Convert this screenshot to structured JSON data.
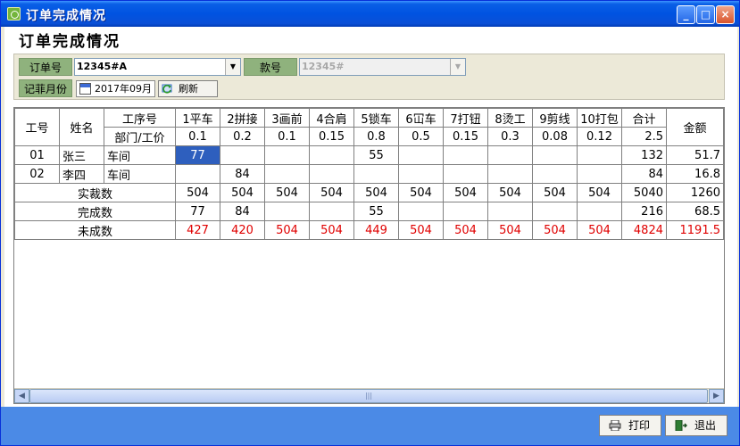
{
  "window": {
    "title": "订单完成情况",
    "min_glyph": "_",
    "max_glyph": "□",
    "close_glyph": "×"
  },
  "header": {
    "title": "订单完成情况"
  },
  "filter": {
    "order_label": "订单号",
    "order_value": "12345#A",
    "style_label": "款号",
    "style_value": "12345#",
    "month_label": "记菲月份",
    "month_value": "2017年09月",
    "refresh_label": "刷新"
  },
  "grid": {
    "h_id": "工号",
    "h_name": "姓名",
    "h_process": "工序号",
    "h_dept": "部门/工价",
    "h_total": "合计",
    "h_amount": "金额",
    "processes": [
      "1平车",
      "2拼接",
      "3画前",
      "4合肩",
      "5锁车",
      "6冚车",
      "7打钮",
      "8烫工",
      "9剪线",
      "10打包"
    ],
    "prices": [
      "0.1",
      "0.2",
      "0.1",
      "0.15",
      "0.8",
      "0.5",
      "0.15",
      "0.3",
      "0.08",
      "0.12"
    ],
    "price_total": "2.5",
    "workers": [
      {
        "id": "01",
        "name": "张三",
        "dept": "车间",
        "cells": [
          "77",
          "",
          "",
          "",
          "55",
          "",
          "",
          "",
          "",
          ""
        ],
        "total": "132",
        "amount": "51.7"
      },
      {
        "id": "02",
        "name": "李四",
        "dept": "车间",
        "cells": [
          "",
          "84",
          "",
          "",
          "",
          "",
          "",
          "",
          "",
          ""
        ],
        "total": "84",
        "amount": "16.8"
      }
    ],
    "summary": [
      {
        "label": "实裁数",
        "cells": [
          "504",
          "504",
          "504",
          "504",
          "504",
          "504",
          "504",
          "504",
          "504",
          "504"
        ],
        "total": "5040",
        "amount": "1260"
      },
      {
        "label": "完成数",
        "cells": [
          "77",
          "84",
          "",
          "",
          "55",
          "",
          "",
          "",
          "",
          ""
        ],
        "total": "216",
        "amount": "68.5"
      },
      {
        "label": "未成数",
        "cells": [
          "427",
          "420",
          "504",
          "504",
          "449",
          "504",
          "504",
          "504",
          "504",
          "504"
        ],
        "total": "4824",
        "amount": "1191.5"
      }
    ]
  },
  "footer": {
    "print_label": "打印",
    "exit_label": "退出"
  },
  "colors": {
    "titlebar": "#0053e1",
    "label_bg": "#8fb27d",
    "selected": "#2e5fbe",
    "negative": "#e00000",
    "footer": "#4b8ae6"
  }
}
